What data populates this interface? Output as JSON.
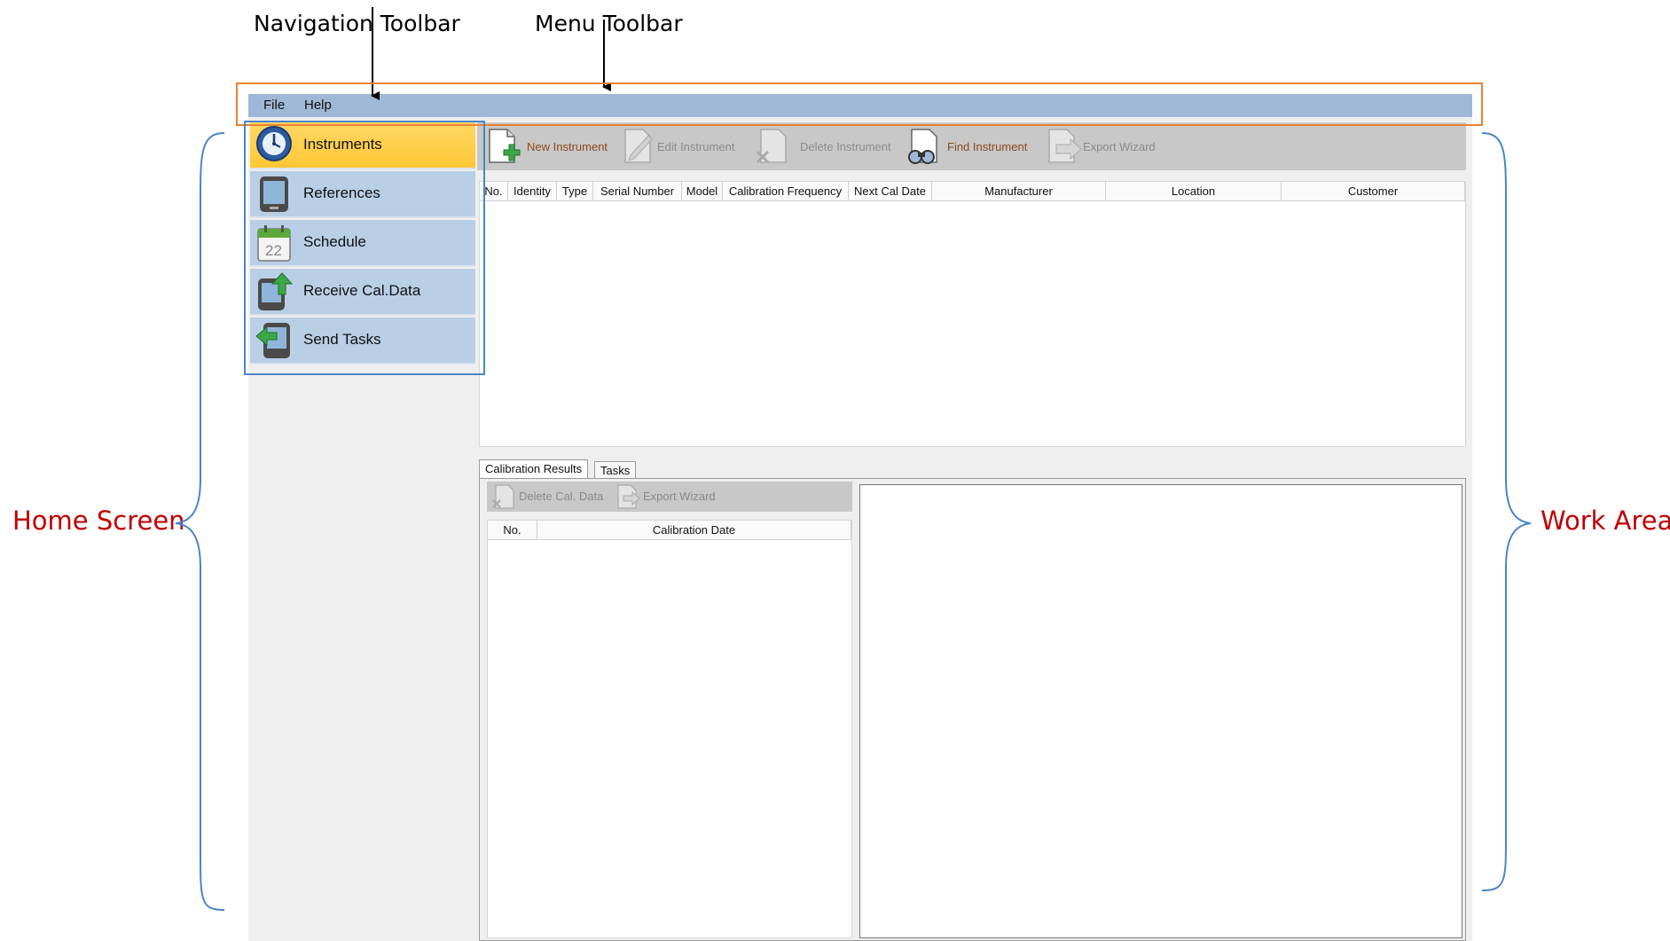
{
  "annotations": {
    "navigation_toolbar": "Navigation Toolbar",
    "menu_toolbar": "Menu Toolbar",
    "home_screen": "Home Screen",
    "work_area": "Work Area"
  },
  "menu": {
    "file": "File",
    "help": "Help"
  },
  "nav": {
    "items": [
      {
        "label": "Instruments",
        "icon": "instrument-gauge-icon",
        "active": true
      },
      {
        "label": "References",
        "icon": "device-tablet-icon"
      },
      {
        "label": "Schedule",
        "icon": "calendar-icon",
        "calendar_day": "22"
      },
      {
        "label": "Receive Cal.Data",
        "icon": "receive-data-icon"
      },
      {
        "label": "Send Tasks",
        "icon": "send-tasks-icon"
      }
    ]
  },
  "toolbar": {
    "new_instrument": "New Instrument",
    "edit_instrument": "Edit Instrument",
    "delete_instrument": "Delete Instrument",
    "find_instrument": "Find Instrument",
    "export_wizard": "Export Wizard"
  },
  "instruments_table": {
    "columns": [
      "No.",
      "Identity",
      "Type",
      "Serial Number",
      "Model",
      "Calibration Frequency",
      "Next Cal Date",
      "Manufacturer",
      "Location",
      "Customer"
    ],
    "rows": []
  },
  "tabs": {
    "calibration_results": "Calibration Results",
    "tasks": "Tasks"
  },
  "results_toolbar": {
    "delete_cal_data": "Delete Cal. Data",
    "export_wizard": "Export Wizard"
  },
  "calibration_table": {
    "columns": [
      "No.",
      "Calibration Date"
    ],
    "rows": []
  },
  "colors": {
    "menubar": "#9fb8d6",
    "nav_item": "#b9cfe6",
    "nav_active": "#ffc733",
    "annotation_orange": "#e8822e",
    "annotation_blue": "#4a86c8",
    "annotation_red": "#c00000",
    "enabled_action_text": "#8b4b1e"
  }
}
